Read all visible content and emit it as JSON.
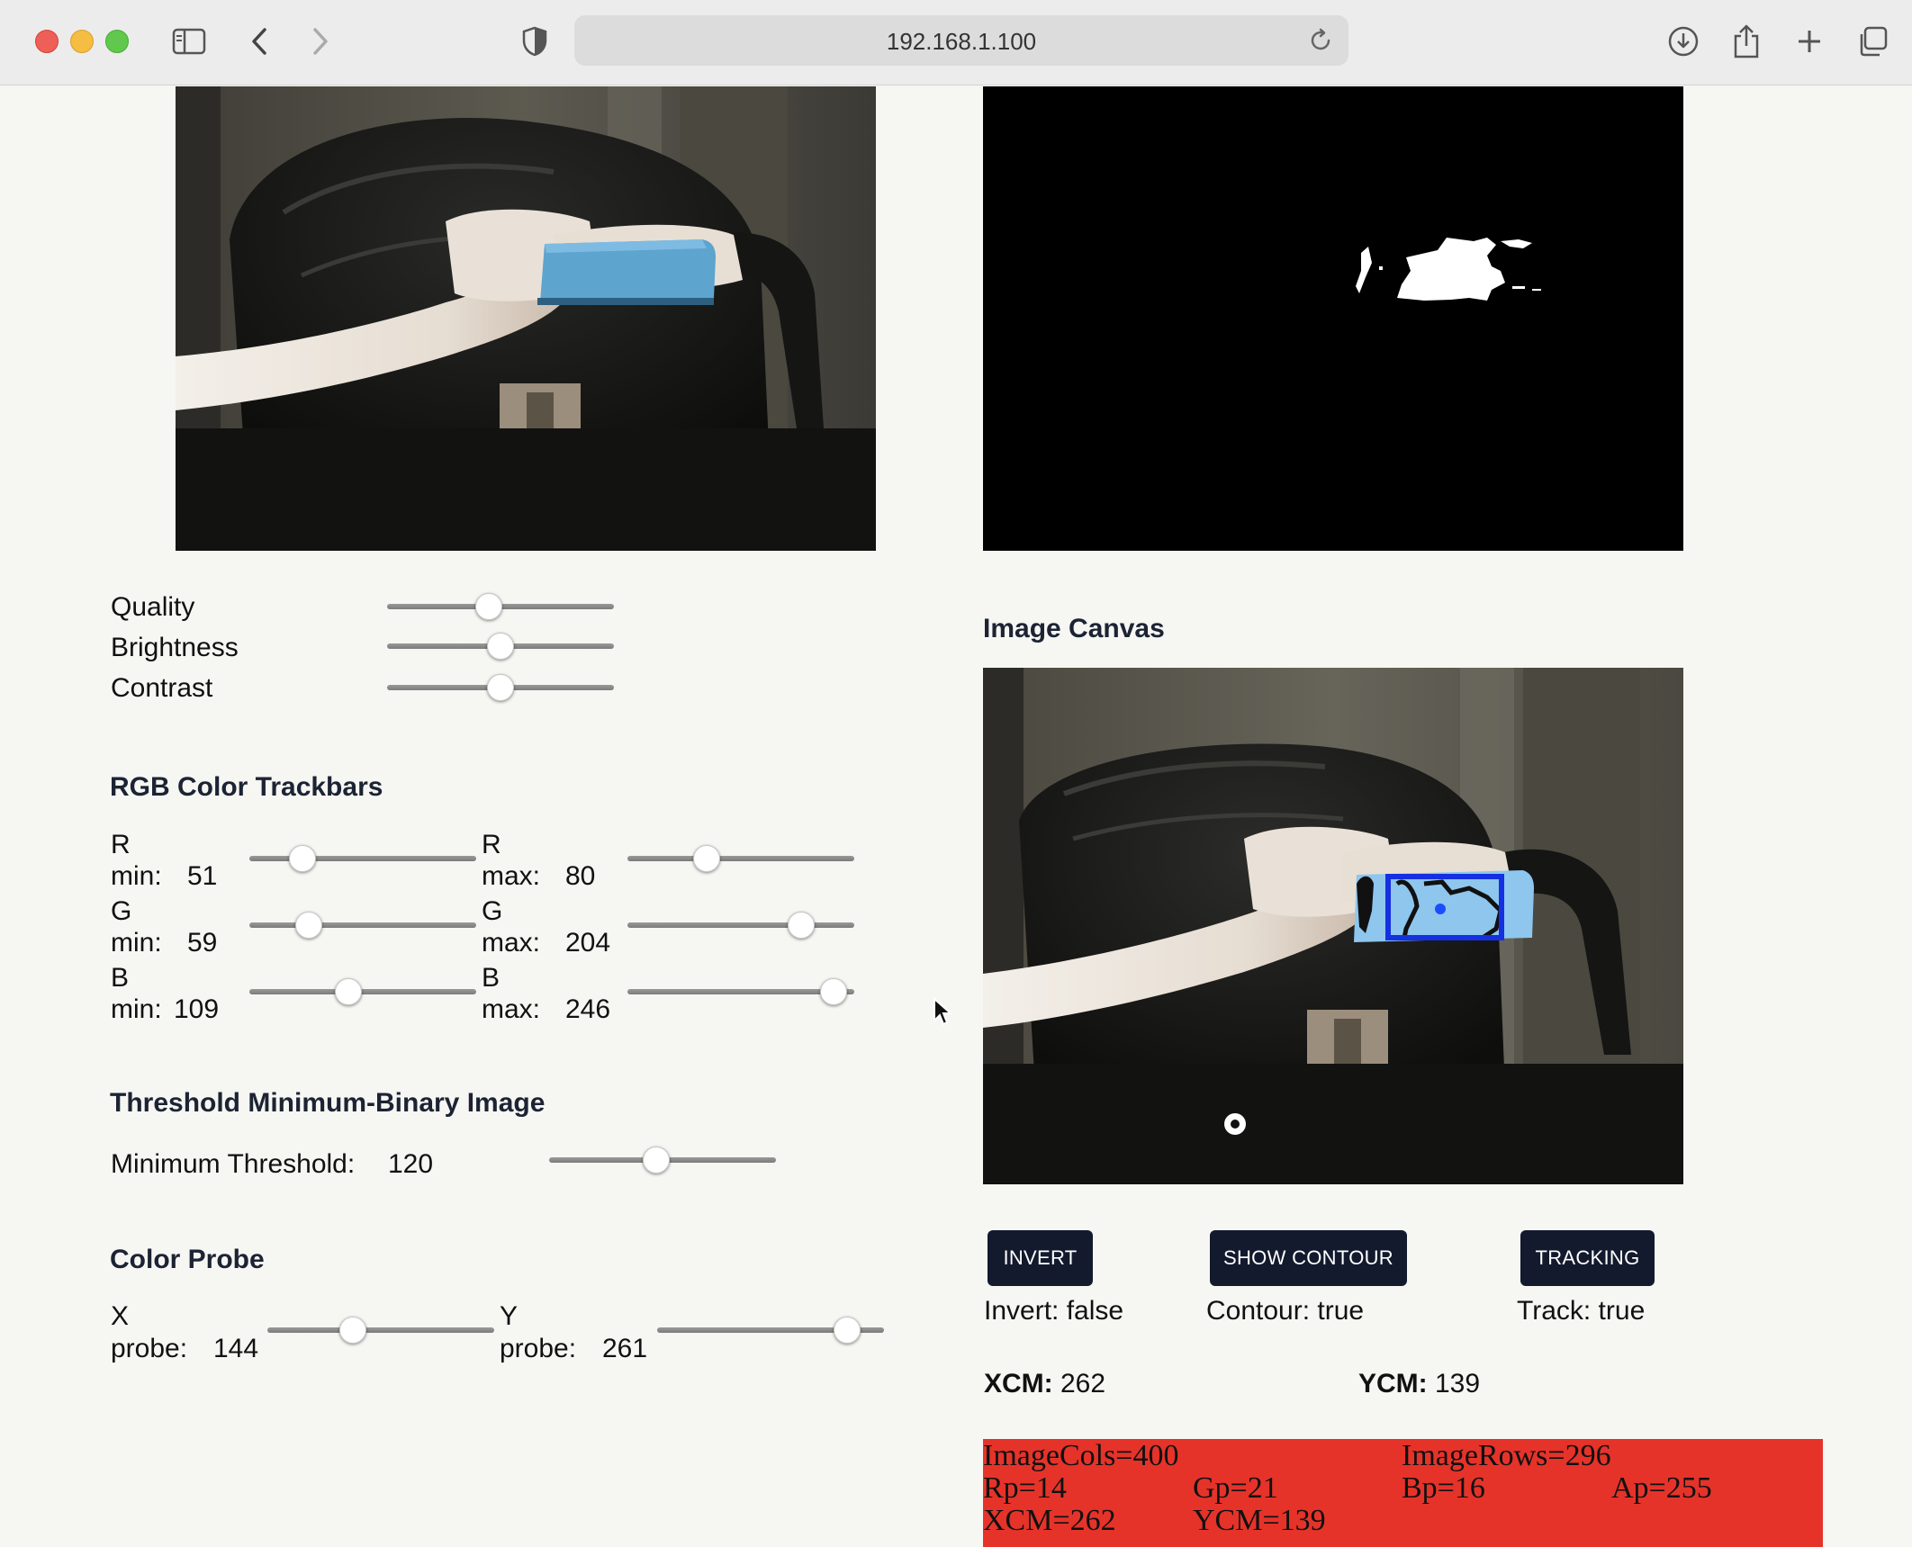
{
  "browser": {
    "url": "192.168.1.100"
  },
  "camera": {
    "quality_label": "Quality",
    "brightness_label": "Brightness",
    "contrast_label": "Contrast",
    "quality_value": 0.44,
    "brightness_value": 0.5,
    "contrast_value": 0.5
  },
  "rgb": {
    "heading": "RGB Color Trackbars",
    "r_min_label": "R",
    "r_min_sub": "min:",
    "r_min": "51",
    "r_max_label": "R",
    "r_max_sub": "max:",
    "r_max": "80",
    "g_min_label": "G",
    "g_min_sub": "min:",
    "g_min": "59",
    "g_max_label": "G",
    "g_max_sub": "max:",
    "g_max": "204",
    "b_min_label": "B",
    "b_min_sub": "min:",
    "b_min": "109",
    "b_max_label": "B",
    "b_max_sub": "max:",
    "b_max": "246",
    "range_max": 255
  },
  "threshold": {
    "heading": "Threshold Minimum-Binary Image",
    "label": "Minimum Threshold:",
    "value": "120",
    "range_max": 255
  },
  "probe": {
    "heading": "Color Probe",
    "x_label": "X",
    "x_sub": "probe:",
    "x_value": "144",
    "y_label": "Y",
    "y_sub": "probe:",
    "y_value": "261",
    "x_max": 400,
    "y_max": 296
  },
  "canvas": {
    "heading": "Image Canvas"
  },
  "controls": {
    "invert_button": "INVERT",
    "contour_button": "SHOW CONTOUR",
    "tracking_button": "TRACKING",
    "invert_status": "Invert: false",
    "contour_status": "Contour: true",
    "track_status": "Track: true"
  },
  "centroid": {
    "xcm_label": "XCM:",
    "xcm_value": "262",
    "ycm_label": "YCM:",
    "ycm_value": "139"
  },
  "debug": {
    "image_cols": "ImageCols=400",
    "image_rows": "ImageRows=296",
    "rp": "Rp=14",
    "gp": "Gp=21",
    "bp": "Bp=16",
    "ap": "Ap=255",
    "xcm": "XCM=262",
    "ycm": "YCM=139"
  }
}
